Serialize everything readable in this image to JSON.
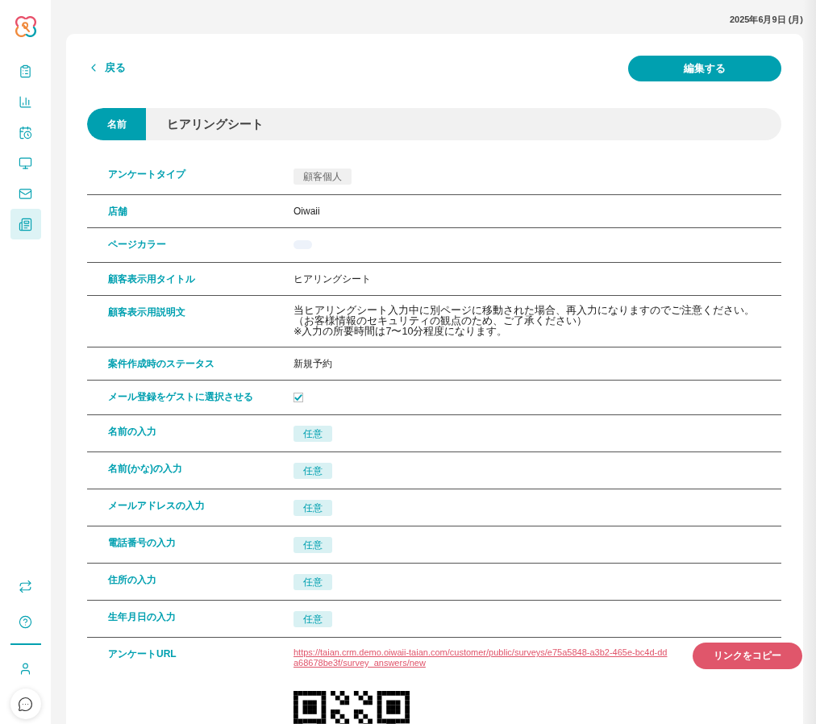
{
  "sidebar": {
    "items": [
      {
        "kind": "clipboard",
        "selected": false
      },
      {
        "kind": "chart",
        "selected": false
      },
      {
        "kind": "calendar",
        "selected": false
      },
      {
        "kind": "monitor",
        "selected": false
      },
      {
        "kind": "mail",
        "selected": false
      },
      {
        "kind": "document",
        "selected": true
      }
    ],
    "bottom_items": [
      {
        "kind": "sync"
      },
      {
        "kind": "help"
      },
      {
        "kind": "user"
      }
    ]
  },
  "date": "2025年6月9日 (月)",
  "back_link": "戻る",
  "edit_button": "編集する",
  "name_field": {
    "label": "名前",
    "value": "ヒアリングシート"
  },
  "fields": [
    {
      "label": "アンケートタイプ",
      "kind": "category",
      "value": "顧客個人"
    },
    {
      "label": "店舗",
      "kind": "text",
      "value": "Oiwaii"
    },
    {
      "label": "ページカラー",
      "kind": "color",
      "color": "#edf2fa"
    },
    {
      "label": "顧客表示用タイトル",
      "kind": "text",
      "value": "ヒアリングシート"
    },
    {
      "label": "顧客表示用説明文",
      "kind": "paragraph",
      "lines": [
        "当ヒアリングシート入力中に別ページに移動された場合、再入力になりますのでご注意ください。",
        "（お客様情報のセキュリティの観点のため、ご了承ください）",
        "※入力の所要時間は7〜10分程度になります。"
      ]
    },
    {
      "label": "案件作成時のステータス",
      "kind": "text",
      "value": "新規予約"
    },
    {
      "label": "メール登録をゲストに選択させる",
      "kind": "checkbox",
      "checked": true
    },
    {
      "label": "名前の入力",
      "kind": "requirement",
      "value": "任意"
    },
    {
      "label": "名前(かな)の入力",
      "kind": "requirement",
      "value": "任意"
    },
    {
      "label": "メールアドレスの入力",
      "kind": "requirement",
      "value": "任意"
    },
    {
      "label": "電話番号の入力",
      "kind": "requirement",
      "value": "任意"
    },
    {
      "label": "住所の入力",
      "kind": "requirement",
      "value": "任意"
    },
    {
      "label": "生年月日の入力",
      "kind": "requirement",
      "value": "任意"
    },
    {
      "label": "アンケートURL",
      "kind": "url",
      "value": "https://taian.crm.demo.oiwaii-taian.com/customer/public/surveys/e75a5848-a3b2-465e-bc4d-dda68678be3f/survey_answers/new",
      "button": "リンクをコピー"
    }
  ]
}
